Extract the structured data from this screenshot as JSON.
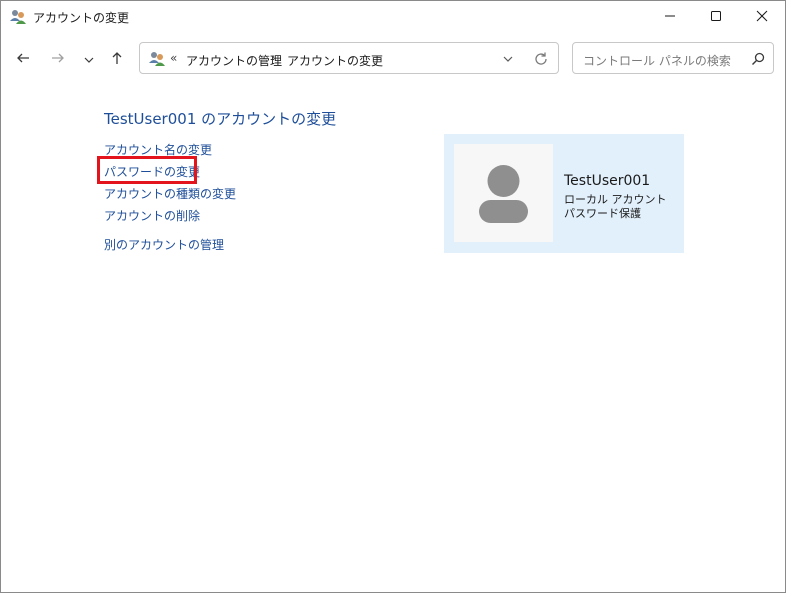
{
  "window": {
    "title": "アカウントの変更",
    "icons": {
      "app": "users-icon",
      "minimize": "minimize-icon",
      "maximize": "maximize-icon",
      "close": "close-icon"
    }
  },
  "navigation": {
    "back_icon": "arrow-left-icon",
    "forward_icon": "arrow-right-icon",
    "recent_icon": "chevron-down-icon",
    "up_icon": "arrow-up-icon",
    "address": {
      "overflow": "«",
      "breadcrumbs": [
        "アカウントの管理",
        "アカウントの変更"
      ],
      "separator": "›",
      "refresh_icon": "refresh-icon"
    },
    "search": {
      "placeholder": "コントロール パネルの検索",
      "icon": "search-icon"
    }
  },
  "main": {
    "heading": "TestUser001 のアカウントの変更",
    "links": [
      "アカウント名の変更",
      "パスワードの変更",
      "アカウントの種類の変更",
      "アカウントの削除"
    ],
    "other_link": "別のアカウントの管理",
    "highlighted_link_index": 1,
    "highlight_color": "#e3141c",
    "link_color": "#1e4e99"
  },
  "user_card": {
    "name": "TestUser001",
    "account_type": "ローカル アカウント",
    "password_status": "パスワード保護",
    "avatar_icon": "user-avatar-icon",
    "background": "#e2f0fc"
  }
}
